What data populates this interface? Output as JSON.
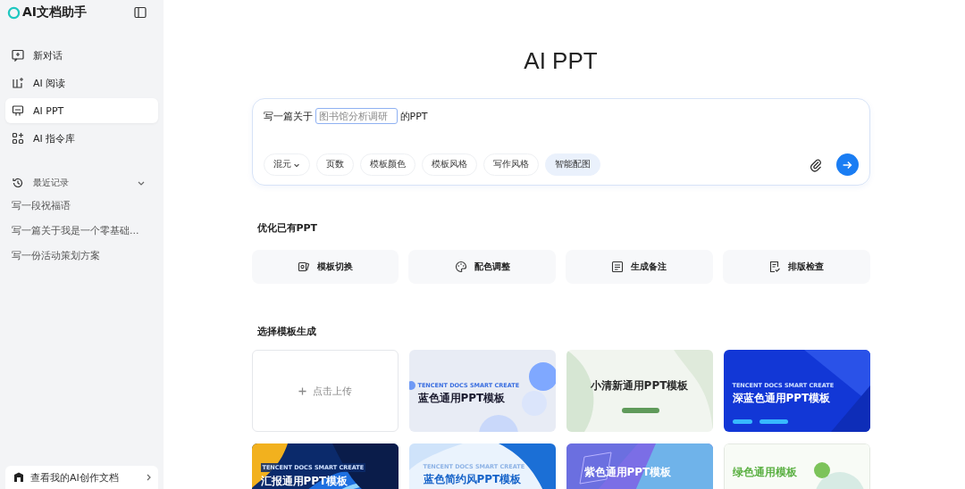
{
  "sidebar": {
    "app_title": "AI文档助手",
    "nav": [
      {
        "label": "新对话",
        "selected": false
      },
      {
        "label": "AI 阅读",
        "selected": false
      },
      {
        "label": "AI PPT",
        "selected": true
      },
      {
        "label": "AI 指令库",
        "selected": false
      }
    ],
    "history": {
      "title": "最近记录",
      "expanded": true,
      "items": [
        "写一段祝福语",
        "写一篇关于我是一个零基础...",
        "写一份活动策划方案"
      ]
    },
    "footer_link": "查看我的AI创作文档"
  },
  "main": {
    "title": "AI PPT",
    "prompt": {
      "before": "写一篇关于",
      "placeholder": "图书馆分析调研",
      "after": "的PPT"
    },
    "chips": [
      {
        "label": "混元",
        "kind": "dropdown",
        "selected": false
      },
      {
        "label": "页数",
        "kind": "plain",
        "selected": false
      },
      {
        "label": "模板颜色",
        "kind": "plain",
        "selected": false
      },
      {
        "label": "模板风格",
        "kind": "plain",
        "selected": false
      },
      {
        "label": "写作风格",
        "kind": "plain",
        "selected": false
      },
      {
        "label": "智能配图",
        "kind": "plain",
        "selected": true
      }
    ],
    "optimize": {
      "title": "优化已有PPT",
      "tools": [
        {
          "label": "模板切换"
        },
        {
          "label": "配色调整"
        },
        {
          "label": "生成备注"
        },
        {
          "label": "排版检查"
        }
      ]
    },
    "templates": {
      "title": "选择模板生成",
      "items": [
        {
          "kind": "upload",
          "label": "点击上传"
        },
        {
          "kind": "template",
          "caption": "TENCENT DOCS SMART CREATE",
          "label": "蓝色通用PPT模板"
        },
        {
          "kind": "template",
          "label": "小清新通用PPT模板"
        },
        {
          "kind": "template",
          "caption": "TENCENT DOCS SMART CREATE",
          "label": "深蓝色通用PPT模板"
        },
        {
          "kind": "template",
          "caption": "TENCENT DOCS SMART CREATE",
          "label": "汇报通用PPT模板"
        },
        {
          "kind": "template",
          "caption": "TENCENT DOCS SMART CREATE",
          "label": "蓝色简约风PPT模板"
        },
        {
          "kind": "template",
          "label": "紫色通用PPT模板"
        },
        {
          "kind": "template",
          "label": "绿色通用模板"
        }
      ]
    }
  }
}
